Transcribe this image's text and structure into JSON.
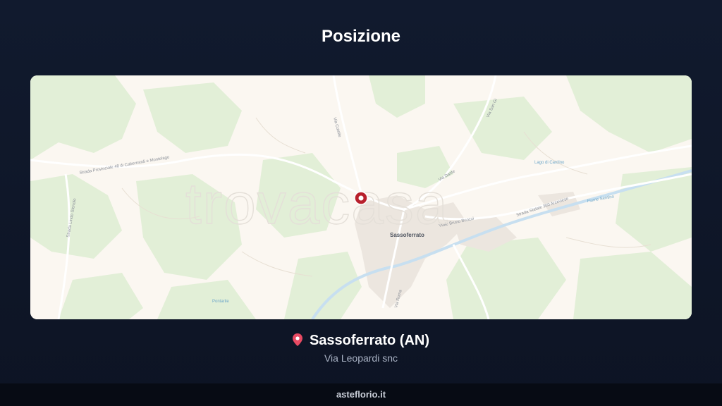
{
  "header": {
    "title": "Posizione"
  },
  "map": {
    "watermark": "trovacasa",
    "town_label": "Sassoferrato",
    "roads": [
      "Strada Provinciale 48 di Cabernardi e Montelago",
      "Via Cotelle",
      "Strada Statale 360 Arceviese",
      "Viale Bruno Buozzi",
      "Via Roma",
      "Via San Gi",
      "Via Dante",
      "Strada Lindo Stenolo"
    ],
    "places": [
      "Lago di Cardino",
      "Fiume Sentino",
      "Pontarile"
    ],
    "marker_icon": "map-marker-icon"
  },
  "location": {
    "pin_icon": "location-pin-icon",
    "city": "Sassoferrato (AN)",
    "address": "Via Leopardi snc"
  },
  "footer": {
    "brand": "asteflorio.it"
  }
}
